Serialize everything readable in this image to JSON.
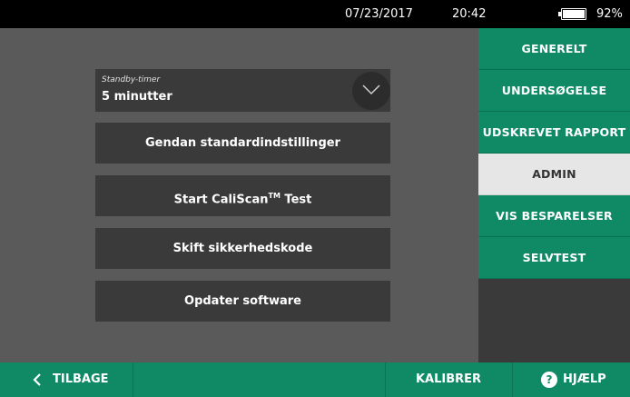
{
  "status": {
    "date": "07/23/2017",
    "time": "20:42",
    "battery_percent_label": "92%",
    "battery_level": 0.92
  },
  "standby": {
    "label": "Standby-timer",
    "value": "5 minutter"
  },
  "buttons": {
    "restore": "Gendan standardindstillinger",
    "caliscan_pre": "Start CaliScan",
    "caliscan_tm": "TM",
    "caliscan_post": " Test",
    "security": "Skift sikkerhedskode",
    "update": "Opdater software"
  },
  "sidebar": {
    "items": [
      {
        "label": "GENERELT",
        "active": false
      },
      {
        "label": "UNDERSØGELSE",
        "active": false
      },
      {
        "label": "UDSKREVET RAPPORT",
        "active": false
      },
      {
        "label": "ADMIN",
        "active": true
      },
      {
        "label": "VIS BESPARELSER",
        "active": false
      },
      {
        "label": "SELVTEST",
        "active": false
      }
    ]
  },
  "bottom": {
    "back": "TILBAGE",
    "calibrate": "KALIBRER",
    "help": "HJÆLP",
    "help_symbol": "?"
  },
  "colors": {
    "accent": "#0f8a64",
    "panel": "#3a3a3a",
    "background": "#5a5a5a",
    "active_tab": "#e6e6e6"
  },
  "icons": {
    "dropdown": "chevron-down-icon",
    "back": "chevron-left-icon",
    "help": "question-circle-icon",
    "battery": "battery-icon"
  }
}
